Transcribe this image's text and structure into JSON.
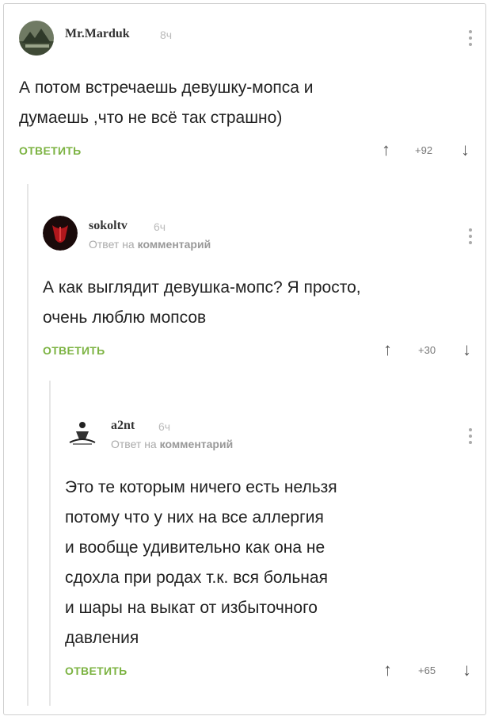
{
  "comments": [
    {
      "username": "Mr.Marduk",
      "time": "8ч",
      "reply_to": null,
      "text_lines": [
        "А потом встречаешь девушку-мопса и",
        "думаешь ,что не всё так страшно)"
      ],
      "reply_label": "ОТВЕТИТЬ",
      "rating": "+92",
      "avatar_icon": "landscape-avatar-icon"
    },
    {
      "username": "sokoltv",
      "time": "6ч",
      "reply_to": {
        "prefix": "Ответ на",
        "target": "комментарий"
      },
      "text_lines": [
        "А как выглядит девушка-мопс? Я просто,",
        "очень люблю мопсов"
      ],
      "reply_label": "ОТВЕТИТЬ",
      "rating": "+30",
      "avatar_icon": "red-emblem-avatar-icon"
    },
    {
      "username": "a2nt",
      "time": "6ч",
      "reply_to": {
        "prefix": "Ответ на",
        "target": "комментарий"
      },
      "text_lines": [
        "Это те которым ничего есть нельзя",
        "потому что у них на все аллергия",
        "и вообще удивительно как она не",
        "сдохла при родах т.к. вся больная",
        "и шары на выкат от избыточного",
        "давления"
      ],
      "reply_label": "ОТВЕТИТЬ",
      "rating": "+65",
      "avatar_icon": "figure-sketch-avatar-icon"
    }
  ],
  "icons": {
    "upvote": "up-arrow-icon",
    "downvote": "down-arrow-icon",
    "menu": "vertical-dots-icon"
  },
  "colors": {
    "accent": "#7cb342",
    "muted": "#aaaaaa"
  }
}
